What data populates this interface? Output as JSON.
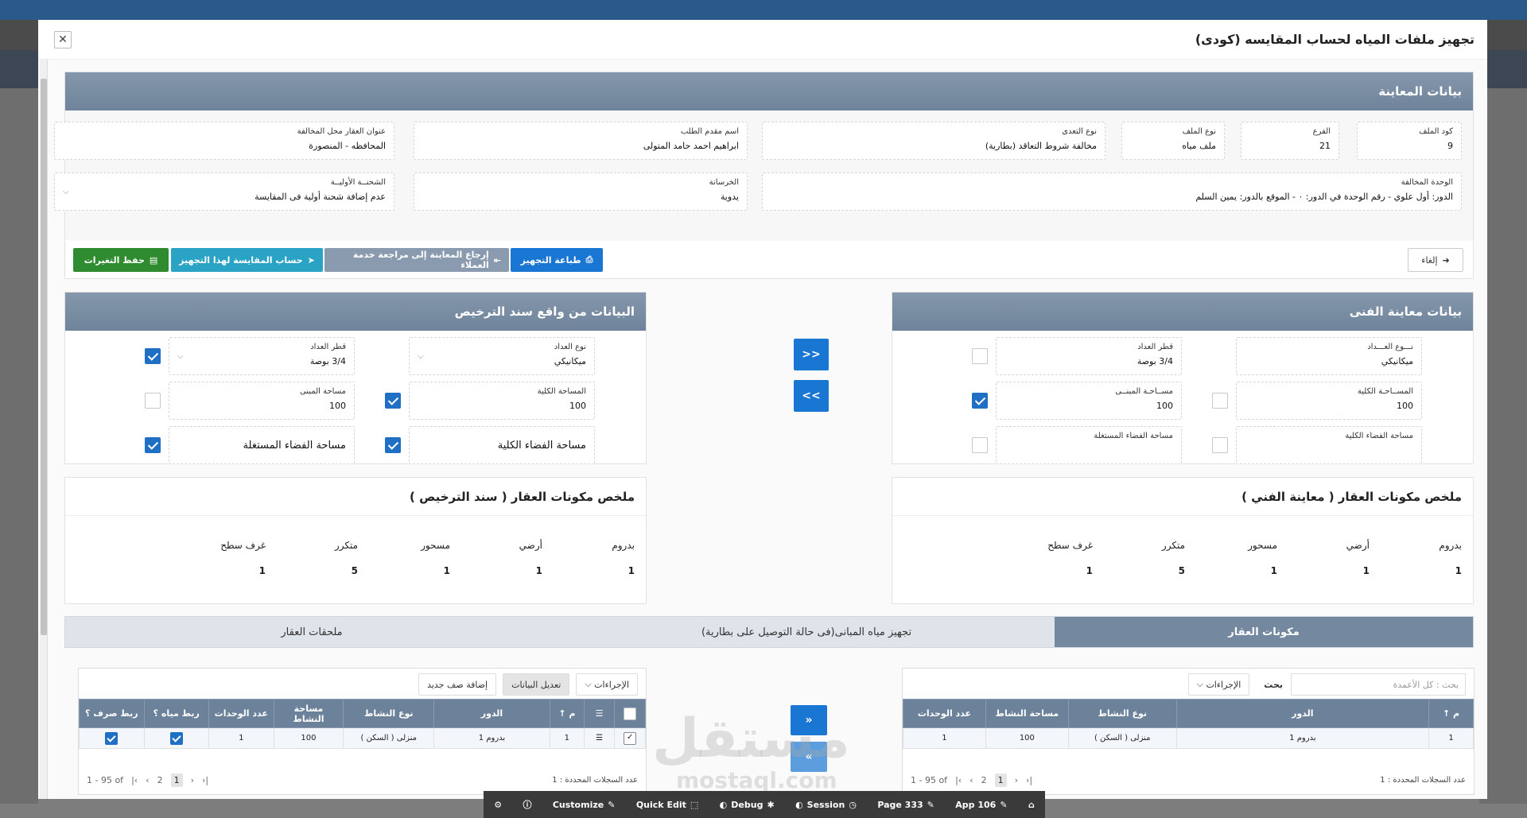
{
  "modal": {
    "title": "تجهيز ملفات المياه لحساب المقايسه (كودى)"
  },
  "inspection": {
    "header": "بيانات المعاينة",
    "file_code": {
      "label": "كود الملف",
      "value": "9"
    },
    "branch": {
      "label": "الفرع",
      "value": "21"
    },
    "file_type": {
      "label": "نوع الملف",
      "value": "ملف مياه"
    },
    "violation_type": {
      "label": "نوع التعدى",
      "value": "مخالفة شروط التعاقد (بطارية)"
    },
    "applicant": {
      "label": "اسم مقدم الطلب",
      "value": "ابراهيم احمد حامد المتولى"
    },
    "address": {
      "label": "عنوان العقار محل المخالفة",
      "value": "المحافظه - المنصورة"
    },
    "unit": {
      "label": "الوحدة المخالفة",
      "value": "الدور: أول علوي - رقم الوحدة في الدور: ٠ - الموقع بالدور: يمين السلم"
    },
    "concrete": {
      "label": "الخرسانة",
      "value": "يدوية"
    },
    "initial_charge": {
      "label": "الشحنــة الأوليــة",
      "value": "عدم إضافة شحنة أولية فى المقايسة"
    }
  },
  "actions": {
    "cancel": "إلغاء",
    "print": "طباعة التجهيز",
    "return": "إرجاع المعاينة إلى مراجعة خدمة العملاء",
    "calc": "حساب المقايسة لهذا التجهيز",
    "save": "حفظ التغيرات"
  },
  "tech": {
    "header": "بيانات معاينة الفنى",
    "meter_type": {
      "label": "نـــوع العـــداد",
      "value": "ميكانيكي"
    },
    "meter_diameter": {
      "label": "قطر العداد",
      "value": "3/4 بوصة"
    },
    "total_area": {
      "label": "المســاحـة الكلية",
      "value": "100"
    },
    "building_area": {
      "label": "مســاحـة المبنــى",
      "value": "100"
    },
    "total_space": {
      "label": "مساحة الفضاء الكلية",
      "value": ""
    },
    "used_space": {
      "label": "مساحة الفضاء المستغلة",
      "value": ""
    }
  },
  "license": {
    "header": "البيانات من واقع سند الترخيص",
    "meter_type": {
      "label": "نوع العداد",
      "value": "ميكانيكي"
    },
    "meter_diameter": {
      "label": "قطر العداد",
      "value": "3/4 بوصة"
    },
    "total_area": {
      "label": "المساحة الكلية",
      "value": "100"
    },
    "building_area": {
      "label": "مساحة المبنى",
      "value": "100"
    },
    "total_space": {
      "label": "مساحة الفضاء الكلية"
    },
    "used_space": {
      "label": "مساحة الفضاء المستغلة"
    }
  },
  "transfer": {
    "btn1": "<<",
    "btn2": ">>",
    "btn3": "«",
    "btn4": "»"
  },
  "summary_tech": {
    "header": "ملخص مكونات العقار ( معاينة الفني )",
    "cols": [
      "بدروم",
      "أرضي",
      "مسحور",
      "متكرر",
      "غرف سطح"
    ],
    "vals": [
      "1",
      "1",
      "1",
      "5",
      "1"
    ]
  },
  "summary_license": {
    "header": "ملخص مكونات العقار ( سند الترخيص )",
    "cols": [
      "بدروم",
      "أرضي",
      "مسحور",
      "متكرر",
      "غرف سطح"
    ],
    "vals": [
      "1",
      "1",
      "1",
      "5",
      "1"
    ]
  },
  "tabs": [
    "مكونات العقار",
    "تجهيز مياه المبانى(فى حالة التوصيل على بطارية)",
    "ملحقات العقار"
  ],
  "grid_right": {
    "search_placeholder": "بحث : كل الأعمدة",
    "search_btn": "بحث",
    "actions": "الإجراءات",
    "headers": [
      "م ↑",
      "الدور",
      "نوع النشاط",
      "مساحة النشاط",
      "عدد الوحدات"
    ],
    "row": [
      "1",
      "بدروم 1",
      "منزلى ( السكن )",
      "100",
      "1"
    ],
    "footer_sel": "عدد السجلات المحددة : 1",
    "range": "1 - 95 of",
    "pages": [
      "1",
      "2"
    ]
  },
  "grid_left": {
    "actions": "الإجراءات",
    "edit": "تعديل البيانات",
    "add": "إضافة صف جديد",
    "headers": [
      "م ↑",
      "الدور",
      "نوع النشاط",
      "مساحة النشاط",
      "عدد الوحدات",
      "ربط مياه ؟",
      "ربط صرف ؟"
    ],
    "row": [
      "1",
      "بدروم 1",
      "منزلى ( السكن )",
      "100",
      "1"
    ],
    "footer_sel": "عدد السجلات المحددة : 1",
    "range": "1 - 95 of",
    "pages": [
      "1",
      "2"
    ]
  },
  "devbar": {
    "customize": "Customize",
    "quick": "Quick Edit",
    "debug": "Debug",
    "session": "Session",
    "page": "Page 333",
    "app": "App 106"
  },
  "watermark": {
    "text": "مستقل",
    "sub": "mostaql.com"
  }
}
